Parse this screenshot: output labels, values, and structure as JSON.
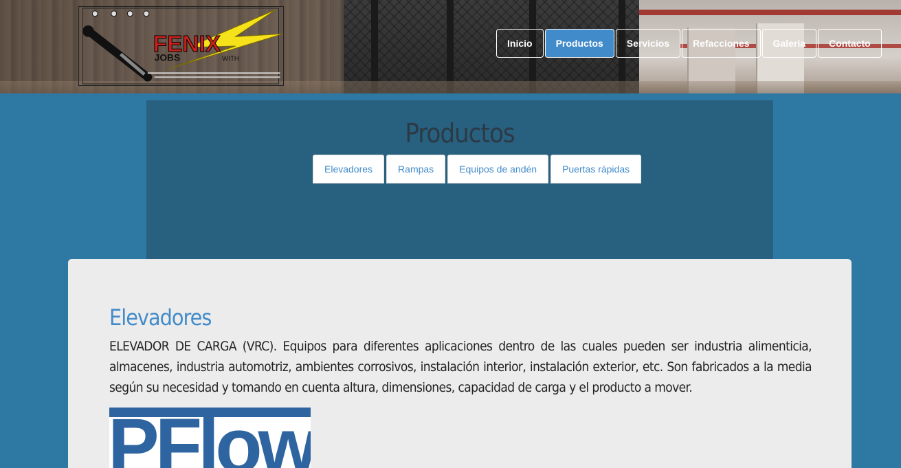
{
  "header": {
    "logo_alt": "Fenix Jobs logo"
  },
  "nav": {
    "items": [
      {
        "label": "Inicio",
        "active": false
      },
      {
        "label": "Productos",
        "active": true
      },
      {
        "label": "Servicios",
        "active": false
      },
      {
        "label": "Refacciones",
        "active": false
      },
      {
        "label": "Galeria",
        "active": false
      },
      {
        "label": "Contacto",
        "active": false
      }
    ]
  },
  "products": {
    "title": "Productos",
    "tabs": [
      {
        "label": "Elevadores"
      },
      {
        "label": "Rampas"
      },
      {
        "label": "Equipos de andén"
      },
      {
        "label": "Puertas rápidas"
      }
    ]
  },
  "content": {
    "section_title": "Elevadores",
    "section_text": "ELEVADOR DE CARGA (VRC). Equipos para diferentes aplicaciones dentro de las cuales pueden ser industria alimenticia, almacenes, industria automotriz, ambientes corrosivos, instalación interior, instalación exterior, etc. Son fabricados a la media según su necesidad y tomando en cuenta altura, dimensiones, capacidad de carga y el producto a mover.",
    "brand_logo_text": "PFlow"
  },
  "colors": {
    "background": "#2e78a4",
    "panel": "#28607f",
    "accent": "#428bca",
    "card": "#ececec",
    "brand": "#2e65a0"
  }
}
